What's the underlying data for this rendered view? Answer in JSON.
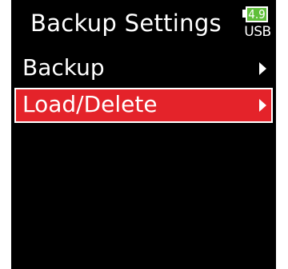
{
  "header": {
    "title": "Backup Settings",
    "battery_level": "4.9",
    "power_source": "USB"
  },
  "menu": {
    "items": [
      {
        "label": "Backup",
        "selected": false
      },
      {
        "label": "Load/Delete",
        "selected": true
      }
    ]
  },
  "colors": {
    "background": "#000000",
    "selection": "#e4232a",
    "battery": "#5fbf3a",
    "text": "#ffffff"
  },
  "icons": {
    "submenu": "chevron-right-icon",
    "battery": "battery-icon"
  }
}
